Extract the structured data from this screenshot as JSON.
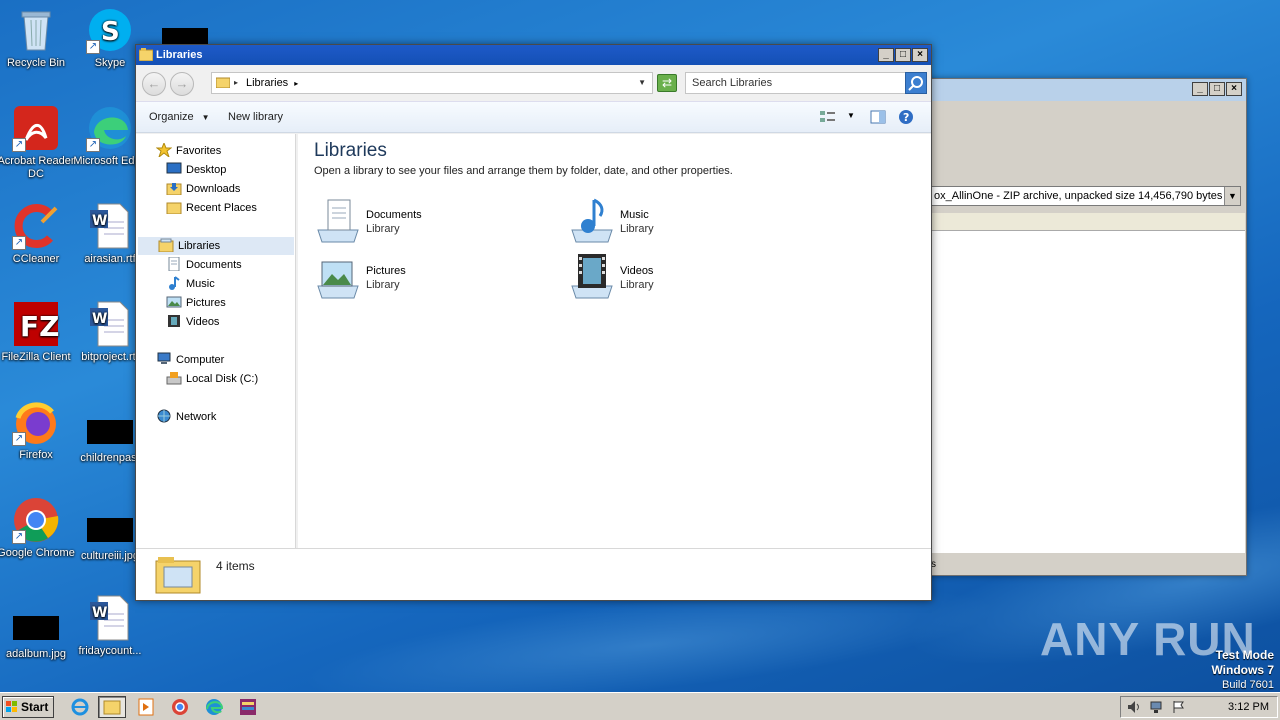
{
  "desktop": {
    "icons": [
      {
        "label": "Recycle Bin"
      },
      {
        "label": "Skype"
      },
      {
        "label": "Acrobat Reader DC"
      },
      {
        "label": "Microsoft Edge"
      },
      {
        "label": "CCleaner"
      },
      {
        "label": "airasian.rtf"
      },
      {
        "label": "FileZilla Client"
      },
      {
        "label": "bitproject.rtf"
      },
      {
        "label": "Firefox"
      },
      {
        "label": "childrenpast"
      },
      {
        "label": "Google Chrome"
      },
      {
        "label": "cultureiii.jpg"
      },
      {
        "label": "adalbum.jpg"
      },
      {
        "label": "fridaycount..."
      }
    ]
  },
  "background_window": {
    "dropdown_text": "ox_AllinOne - ZIP archive, unpacked size 14,456,790 bytes",
    "status_text": "s"
  },
  "explorer": {
    "title": "Libraries",
    "address": "Libraries",
    "search_placeholder": "Search Libraries",
    "toolbar": {
      "organize": "Organize",
      "new_library": "New library"
    },
    "nav": {
      "favorites": "Favorites",
      "desktop": "Desktop",
      "downloads": "Downloads",
      "recent_places": "Recent Places",
      "libraries": "Libraries",
      "documents": "Documents",
      "music": "Music",
      "pictures": "Pictures",
      "videos": "Videos",
      "computer": "Computer",
      "local_disk": "Local Disk (C:)",
      "network": "Network"
    },
    "content": {
      "title": "Libraries",
      "description": "Open a library to see your files and arrange them by folder, date, and other properties.",
      "libraries": [
        {
          "name": "Documents",
          "type": "Library"
        },
        {
          "name": "Music",
          "type": "Library"
        },
        {
          "name": "Pictures",
          "type": "Library"
        },
        {
          "name": "Videos",
          "type": "Library"
        }
      ]
    },
    "details": {
      "count": "4 items"
    }
  },
  "watermark": {
    "text": "ANY RUN"
  },
  "os_info": {
    "line1": "Test Mode",
    "line2": "Windows 7",
    "line3": "Build 7601"
  },
  "taskbar": {
    "start": "Start",
    "clock": "3:12 PM"
  },
  "colors": {
    "titlebar": "#1e5ac8",
    "desktop": "#1a6fc4",
    "selection": "#dde8f5"
  }
}
